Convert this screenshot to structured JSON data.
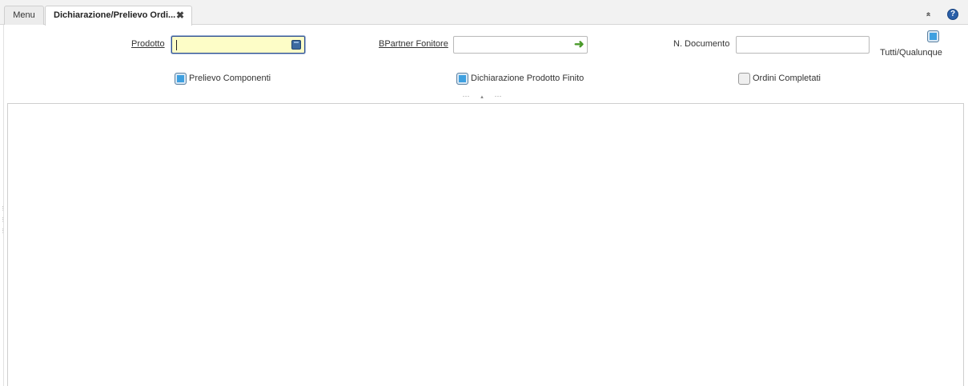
{
  "tabs": {
    "menu_label": "Menu",
    "active_label": "Dichiarazione/Prelievo Ordi...",
    "close_glyph": "✖"
  },
  "toolbar": {
    "collapse_glyph": "»",
    "help_glyph": "?"
  },
  "form": {
    "prodotto_label": "Prodotto",
    "prodotto_value": "",
    "bpartner_label": "BPartner Fonitore",
    "bpartner_value": "",
    "ndocumento_label": "N. Documento",
    "ndocumento_value": "",
    "tutti_label": "Tutti/Qualunque",
    "tutti_checked": true,
    "prelievo_label": "Prelievo Componenti",
    "prelievo_checked": true,
    "dichiarazione_label": "Dichiarazione Prodotto Finito",
    "dichiarazione_checked": true,
    "ordini_label": "Ordini Completati",
    "ordini_checked": false
  },
  "splitter": {
    "left_glyph": "···",
    "up_glyph": "▲",
    "right_glyph": "···"
  },
  "colors": {
    "accent": "#3ea0e0",
    "focus_bg": "#fdfdc7",
    "help_blue": "#2a5fa8",
    "go_green": "#4a9a2a"
  },
  "icons": [
    "close-icon",
    "collapse-icon",
    "help-icon",
    "book-icon",
    "arrow-right-icon",
    "checkbox-icon"
  ]
}
